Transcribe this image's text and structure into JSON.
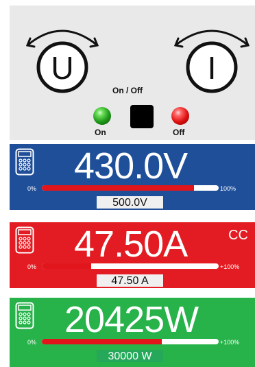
{
  "controls": {
    "knob_voltage_label": "U",
    "knob_current_label": "I",
    "onoff_title": "On / Off",
    "led_on_label": "On",
    "led_off_label": "Off"
  },
  "voltage": {
    "value": "430.0V",
    "min_label": "0%",
    "max_label": "100%",
    "bar_fill": 0.86,
    "set_value": "500.0V",
    "color": "#1f4f99"
  },
  "current": {
    "value": "47.50A",
    "mode": "CC",
    "min_label": "0%",
    "max_label": "+100%",
    "bar_fill": 0.28,
    "set_value": "47.50 A",
    "color": "#e21c22"
  },
  "power": {
    "value": "20425W",
    "min_label": "0%",
    "max_label": "+100%",
    "bar_fill": 0.68,
    "set_value": "30000 W",
    "color": "#27b24a"
  },
  "icons": [
    "rotate-arrow-icon",
    "calculator-icon",
    "led-icon"
  ]
}
